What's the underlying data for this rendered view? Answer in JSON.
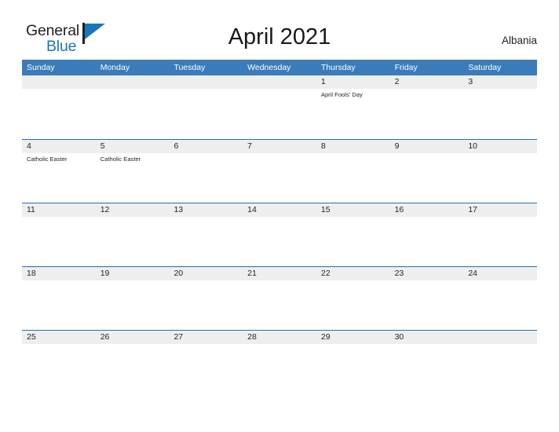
{
  "brand": {
    "name_part1": "General",
    "name_part2": "Blue",
    "icon": "flag-triangle-icon",
    "colors": {
      "dark": "#231f20",
      "blue": "#1b75bb"
    }
  },
  "header": {
    "title": "April 2021",
    "country": "Albania"
  },
  "theme": {
    "header_blue": "#3a7cba",
    "row_divider_blue": "#2f6da8",
    "day_band_gray": "#eeeeee",
    "text_dark": "#231f20",
    "text_white": "#ffffff"
  },
  "calendar": {
    "month": "April",
    "year": "2021",
    "weekday_headers": [
      "Sunday",
      "Monday",
      "Tuesday",
      "Wednesday",
      "Thursday",
      "Friday",
      "Saturday"
    ],
    "weeks": [
      {
        "days": [
          {
            "date": "",
            "events": []
          },
          {
            "date": "",
            "events": []
          },
          {
            "date": "",
            "events": []
          },
          {
            "date": "",
            "events": []
          },
          {
            "date": "1",
            "events": [
              "April Fools' Day"
            ]
          },
          {
            "date": "2",
            "events": []
          },
          {
            "date": "3",
            "events": []
          }
        ]
      },
      {
        "days": [
          {
            "date": "4",
            "events": [
              "Catholic Easter"
            ]
          },
          {
            "date": "5",
            "events": [
              "Catholic Easter"
            ]
          },
          {
            "date": "6",
            "events": []
          },
          {
            "date": "7",
            "events": []
          },
          {
            "date": "8",
            "events": []
          },
          {
            "date": "9",
            "events": []
          },
          {
            "date": "10",
            "events": []
          }
        ]
      },
      {
        "days": [
          {
            "date": "11",
            "events": []
          },
          {
            "date": "12",
            "events": []
          },
          {
            "date": "13",
            "events": []
          },
          {
            "date": "14",
            "events": []
          },
          {
            "date": "15",
            "events": []
          },
          {
            "date": "16",
            "events": []
          },
          {
            "date": "17",
            "events": []
          }
        ]
      },
      {
        "days": [
          {
            "date": "18",
            "events": []
          },
          {
            "date": "19",
            "events": []
          },
          {
            "date": "20",
            "events": []
          },
          {
            "date": "21",
            "events": []
          },
          {
            "date": "22",
            "events": []
          },
          {
            "date": "23",
            "events": []
          },
          {
            "date": "24",
            "events": []
          }
        ]
      },
      {
        "days": [
          {
            "date": "25",
            "events": []
          },
          {
            "date": "26",
            "events": []
          },
          {
            "date": "27",
            "events": []
          },
          {
            "date": "28",
            "events": []
          },
          {
            "date": "29",
            "events": []
          },
          {
            "date": "30",
            "events": []
          },
          {
            "date": "",
            "events": []
          }
        ]
      }
    ]
  }
}
